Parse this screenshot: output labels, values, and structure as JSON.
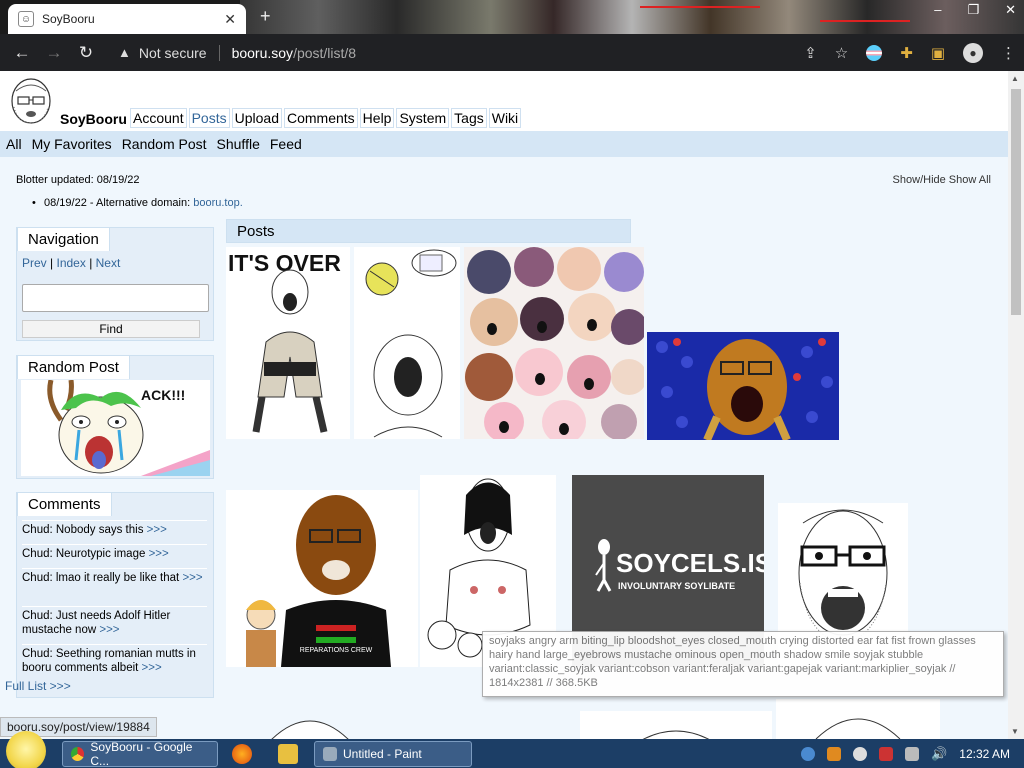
{
  "browser": {
    "tab_title": "SoyBooru",
    "not_secure_label": "Not secure",
    "url_host": "booru.soy",
    "url_path": "/post/list/8",
    "status_url": "booru.soy/post/view/19884"
  },
  "header": {
    "site_title": "SoyBooru",
    "nav": [
      "Account",
      "Posts",
      "Upload",
      "Comments",
      "Help",
      "System",
      "Tags",
      "Wiki"
    ],
    "active_nav": "Posts"
  },
  "subnav": [
    "All",
    "My Favorites",
    "Random Post",
    "Shuffle",
    "Feed"
  ],
  "blotter": {
    "updated": "Blotter updated: 08/19/22",
    "toggle": "Show/Hide Show All",
    "entry_prefix": "08/19/22 - Alternative domain: ",
    "entry_link": "booru.top."
  },
  "navigation_block": {
    "title": "Navigation",
    "prev": "Prev",
    "index": "Index",
    "next": "Next",
    "find_label": "Find",
    "search_value": ""
  },
  "random_post_block": {
    "title": "Random Post",
    "image_caption": "ACK!!!"
  },
  "comments_block": {
    "title": "Comments",
    "items": [
      {
        "text": "Chud: Nobody says this",
        "link": ">>>"
      },
      {
        "text": "Chud: Neurotypic image",
        "link": ">>>"
      },
      {
        "text": "Chud: lmao it really be like that",
        "link": ">>>"
      },
      {
        "text": "Chud: Just needs Adolf Hitler mustache now",
        "link": ">>>"
      },
      {
        "text": "Chud: Seething romanian mutts in booru comments albeit",
        "link": ">>>"
      }
    ],
    "full_list": "Full List >>>"
  },
  "posts": {
    "title": "Posts",
    "thumb_texts": {
      "its_over": "IT'S OVER",
      "soycels_title": "SOYCELS.IS",
      "soycels_subtitle": "INVOLUNTARY SOYLIBATE",
      "crew_shirt": "REPARATIONS CREW"
    }
  },
  "tooltip": "soyjaks angry arm biting_lip bloodshot_eyes closed_mouth crying distorted ear fat fist frown glasses hairy hand large_eyebrows mustache ominous open_mouth shadow smile soyjak stubble variant:classic_soyjak variant:cobson variant:feraljak variant:gapejak variant:markiplier_soyjak // 1814x2381 // 368.5KB",
  "taskbar": {
    "chrome_task": "SoyBooru - Google C...",
    "paint_task": "Untitled - Paint",
    "clock": "12:32 AM"
  }
}
